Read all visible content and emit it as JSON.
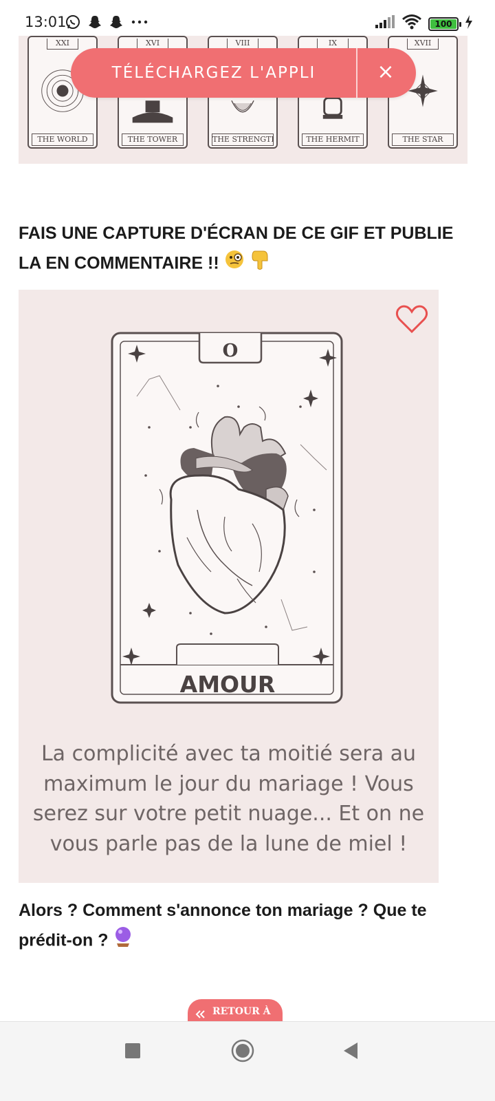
{
  "status_bar": {
    "time": "13:01",
    "icons": [
      "whatsapp-icon",
      "snapchat-icon",
      "snapchat-icon",
      "more-dots-icon"
    ],
    "right_icons": [
      "signal-icon",
      "wifi-icon",
      "battery-icon",
      "charging-icon"
    ],
    "battery_level": "100"
  },
  "tarot_strip": {
    "cards": [
      {
        "numeral": "XXI",
        "name": "THE WORLD"
      },
      {
        "numeral": "XVI",
        "name": "THE TOWER"
      },
      {
        "numeral": "VIII",
        "name": "THE STRENGTH"
      },
      {
        "numeral": "IX",
        "name": "THE HERMIT"
      },
      {
        "numeral": "XVII",
        "name": "THE STAR"
      }
    ]
  },
  "app_banner": {
    "label": "TÉLÉCHARGEZ L'APPLI",
    "close_label": "×"
  },
  "article": {
    "heading": "FAIS UNE CAPTURE D'ÉCRAN DE CE GIF ET PUBLIE LA EN COMMENTAIRE !!",
    "heading_emojis": [
      "monocle-face-emoji",
      "pointing-down-emoji"
    ],
    "card": {
      "numeral": "O",
      "title": "AMOUR",
      "text_lines": [
        "La complicité avec ta moitié sera au",
        "maximum le jour du mariage ! Vous",
        "serez sur votre petit nuage... Et on ne",
        "vous parle pas de la lune de miel !"
      ]
    },
    "question": "Alors ? Comment s'annonce ton mariage ? Que te prédit-on ?",
    "question_emoji": "crystal-ball-emoji"
  },
  "back_button": {
    "label": "RETOUR À"
  },
  "nav_bar": {
    "items": [
      "recents-square-icon",
      "home-circle-icon",
      "back-triangle-icon"
    ]
  },
  "colors": {
    "accent": "#f06f72",
    "card_bg": "#f3e9e8",
    "ink": "#5a5050"
  }
}
